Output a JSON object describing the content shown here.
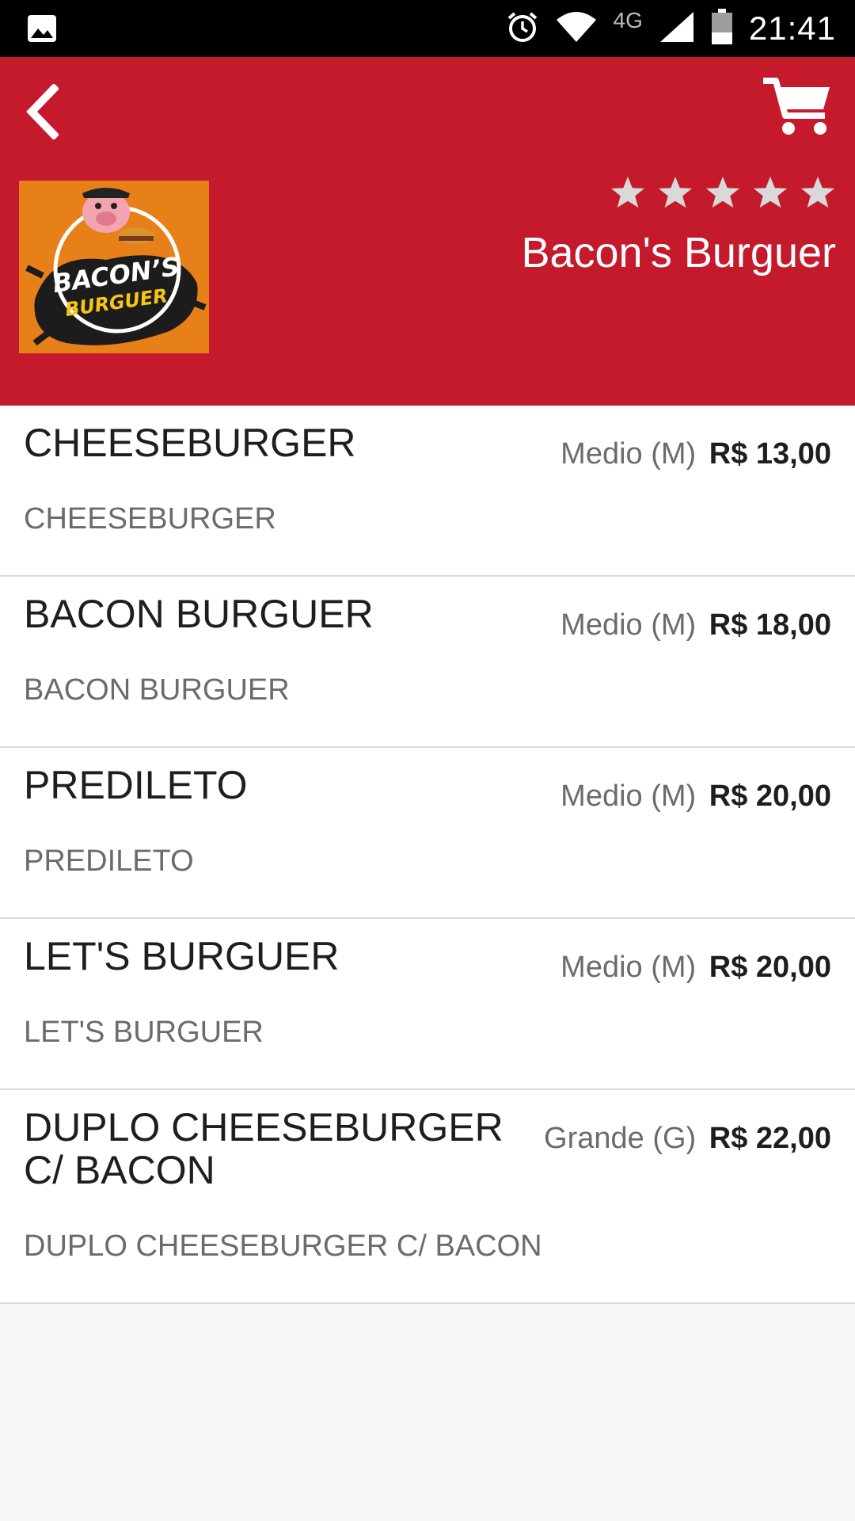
{
  "status_bar": {
    "time": "21:41",
    "network": "4G",
    "icons": [
      "image-icon",
      "alarm-icon",
      "wifi-icon",
      "signal-icon",
      "battery-icon"
    ]
  },
  "header": {
    "back_icon": "chevron-left-icon",
    "cart_icon": "cart-icon",
    "store_name": "Bacon's Burguer",
    "logo_text": "BACON'S BURGUER",
    "rating_stars": 5,
    "accent_color": "#c41a2b"
  },
  "menu": {
    "items": [
      {
        "name": "CHEESEBURGER",
        "description": "CHEESEBURGER",
        "size": "Medio (M)",
        "price": "R$ 13,00"
      },
      {
        "name": "BACON BURGUER",
        "description": "BACON BURGUER",
        "size": "Medio (M)",
        "price": "R$ 18,00"
      },
      {
        "name": "PREDILETO",
        "description": "PREDILETO",
        "size": "Medio (M)",
        "price": "R$ 20,00"
      },
      {
        "name": "LET'S BURGUER",
        "description": "LET'S BURGUER",
        "size": "Medio (M)",
        "price": "R$ 20,00"
      },
      {
        "name": "DUPLO CHEESEBURGER C/ BACON",
        "description": "DUPLO CHEESEBURGER C/ BACON",
        "size": "Grande (G)",
        "price": "R$ 22,00"
      }
    ]
  }
}
